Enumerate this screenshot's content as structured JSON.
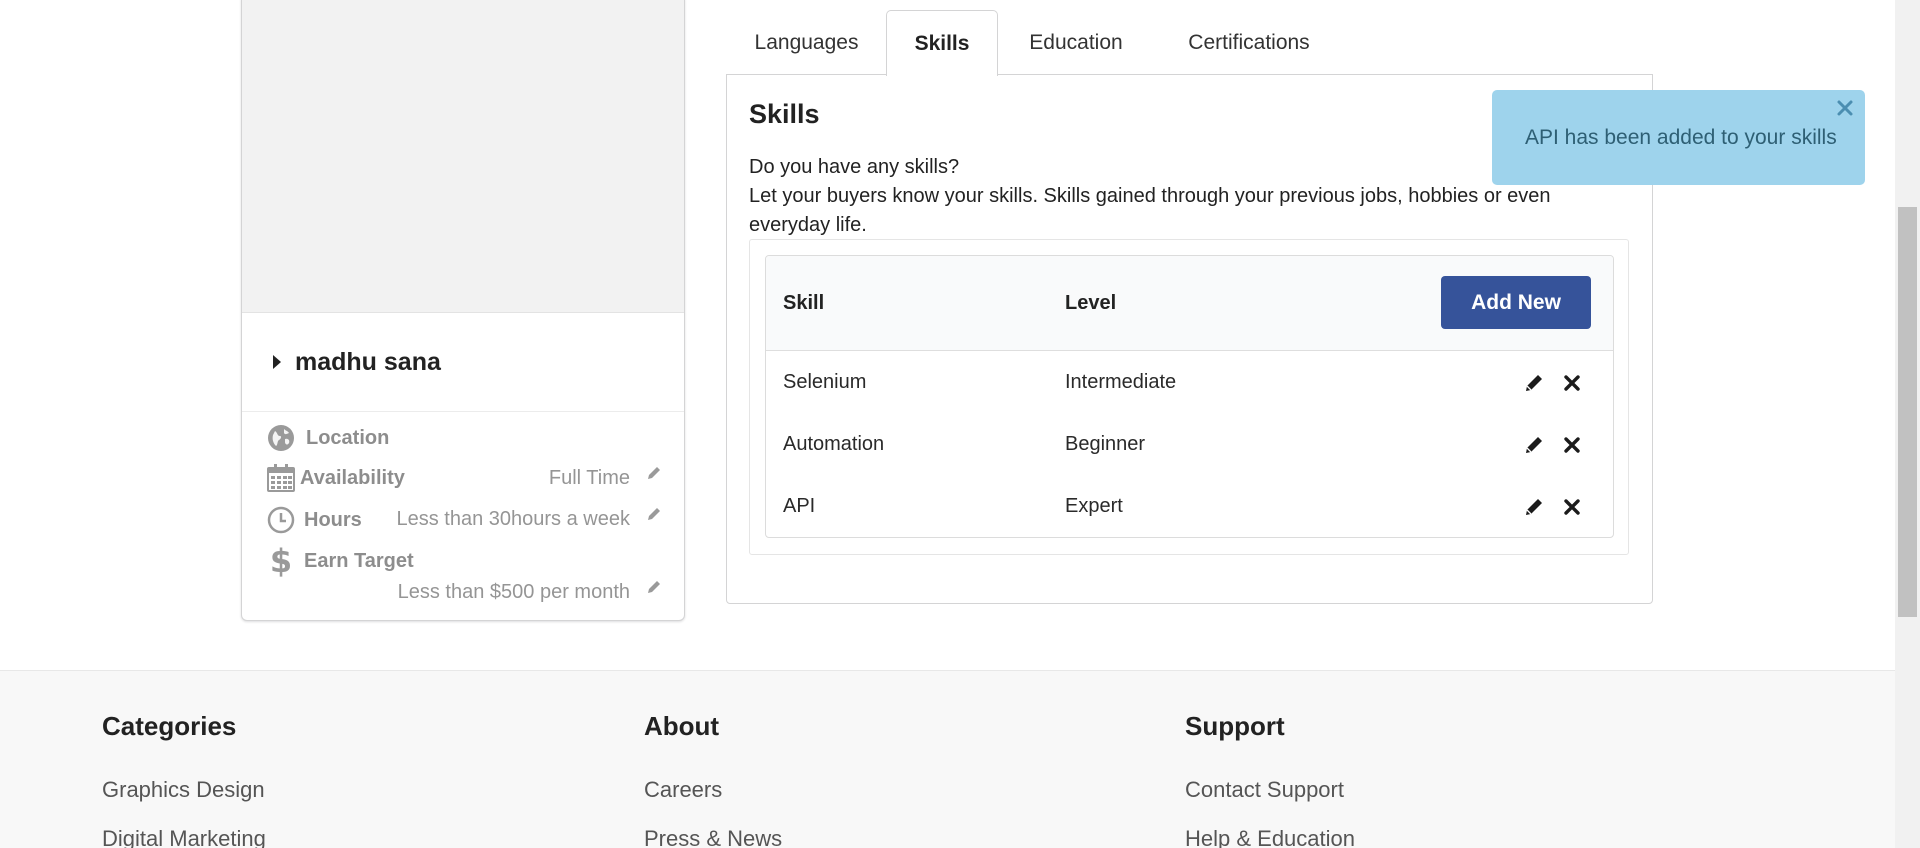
{
  "profile": {
    "name": "madhu sana",
    "location_label": "Location",
    "availability_label": "Availability",
    "availability_value": "Full Time",
    "hours_label": "Hours",
    "hours_value": "Less than 30hours a week",
    "earn_target_label": "Earn Target",
    "earn_target_value": "Less than $500 per month"
  },
  "tabs": [
    {
      "label": "Languages",
      "active": false
    },
    {
      "label": "Skills",
      "active": true
    },
    {
      "label": "Education",
      "active": false
    },
    {
      "label": "Certifications",
      "active": false
    }
  ],
  "skills_section": {
    "title": "Skills",
    "question": "Do you have any skills?",
    "description": "Let your buyers know your skills. Skills gained through your previous jobs, hobbies or even everyday life.",
    "columns": {
      "skill": "Skill",
      "level": "Level"
    },
    "add_new_label": "Add New",
    "rows": [
      {
        "skill": "Selenium",
        "level": "Intermediate"
      },
      {
        "skill": "Automation",
        "level": "Beginner"
      },
      {
        "skill": "API",
        "level": "Expert"
      }
    ]
  },
  "toast": {
    "message": "API has been added to your skills"
  },
  "footer": {
    "columns": [
      {
        "heading": "Categories",
        "links": [
          "Graphics Design",
          "Digital Marketing"
        ]
      },
      {
        "heading": "About",
        "links": [
          "Careers",
          "Press & News"
        ]
      },
      {
        "heading": "Support",
        "links": [
          "Contact Support",
          "Help & Education"
        ]
      }
    ]
  },
  "colors": {
    "primary_button": "#36539a",
    "toast_background": "#9ed3ec",
    "toast_text": "#2e5f74"
  }
}
